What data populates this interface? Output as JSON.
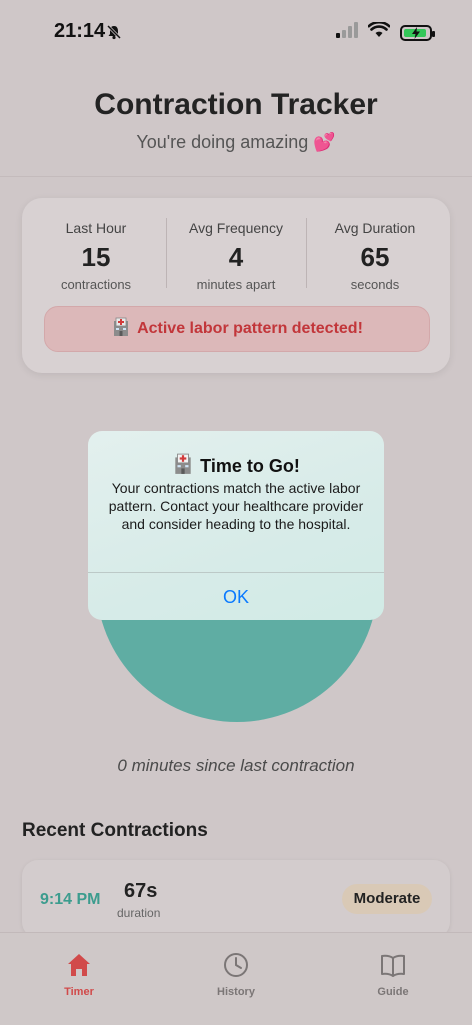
{
  "status_bar": {
    "time": "21:14"
  },
  "header": {
    "title": "Contraction Tracker",
    "subtitle": "You're doing amazing 💕"
  },
  "stats": {
    "last_hour": {
      "label": "Last Hour",
      "value": "15",
      "unit": "contractions"
    },
    "avg_frequency": {
      "label": "Avg Frequency",
      "value": "4",
      "unit": "minutes apart"
    },
    "avg_duration": {
      "label": "Avg Duration",
      "value": "65",
      "unit": "seconds"
    },
    "alert": "Active labor pattern detected!"
  },
  "timer": {
    "since_text": "0 minutes since last contraction"
  },
  "recent": {
    "title": "Recent Contractions",
    "items": [
      {
        "time": "9:14 PM",
        "duration": "67s",
        "duration_label": "duration",
        "intensity": "Moderate"
      }
    ]
  },
  "tabs": [
    {
      "label": "Timer",
      "icon": "home-icon",
      "active": true
    },
    {
      "label": "History",
      "icon": "clock-icon",
      "active": false
    },
    {
      "label": "Guide",
      "icon": "book-icon",
      "active": false
    }
  ],
  "dialog": {
    "title": "Time to Go!",
    "message": "Your contractions match the active labor pattern. Contact your healthcare provider and consider heading to the hospital.",
    "ok_label": "OK"
  },
  "colors": {
    "accent_teal": "#5fada3",
    "alert_red": "#c2363a",
    "tab_active": "#d14a4a",
    "link_blue": "#0a7aff"
  }
}
